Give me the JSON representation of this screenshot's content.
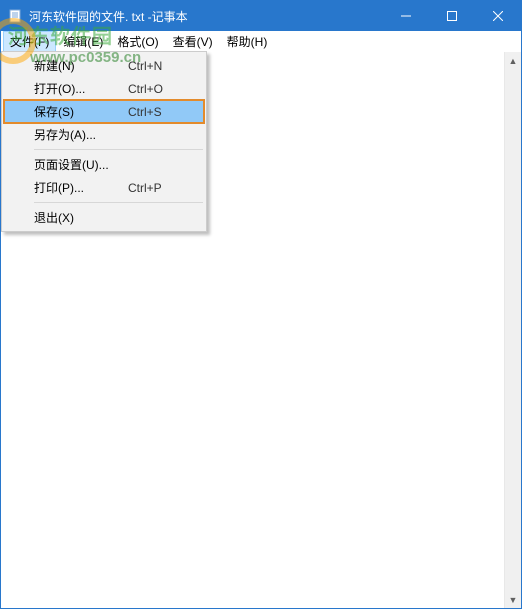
{
  "window": {
    "title": "河东软件园的文件. txt -记事本"
  },
  "menubar": {
    "items": [
      "文件(F)",
      "编辑(E)",
      "格式(O)",
      "查看(V)",
      "帮助(H)"
    ]
  },
  "dropdown": {
    "items": [
      {
        "label": "新建(N)",
        "shortcut": "Ctrl+N"
      },
      {
        "label": "打开(O)...",
        "shortcut": "Ctrl+O"
      },
      {
        "label": "保存(S)",
        "shortcut": "Ctrl+S",
        "highlight": true
      },
      {
        "label": "另存为(A)...",
        "shortcut": ""
      },
      {
        "separator": true
      },
      {
        "label": "页面设置(U)...",
        "shortcut": ""
      },
      {
        "label": "打印(P)...",
        "shortcut": "Ctrl+P"
      },
      {
        "separator": true
      },
      {
        "label": "退出(X)",
        "shortcut": ""
      }
    ]
  },
  "watermark": {
    "main": "河东软件园",
    "url": "www.pc0359.cn"
  }
}
